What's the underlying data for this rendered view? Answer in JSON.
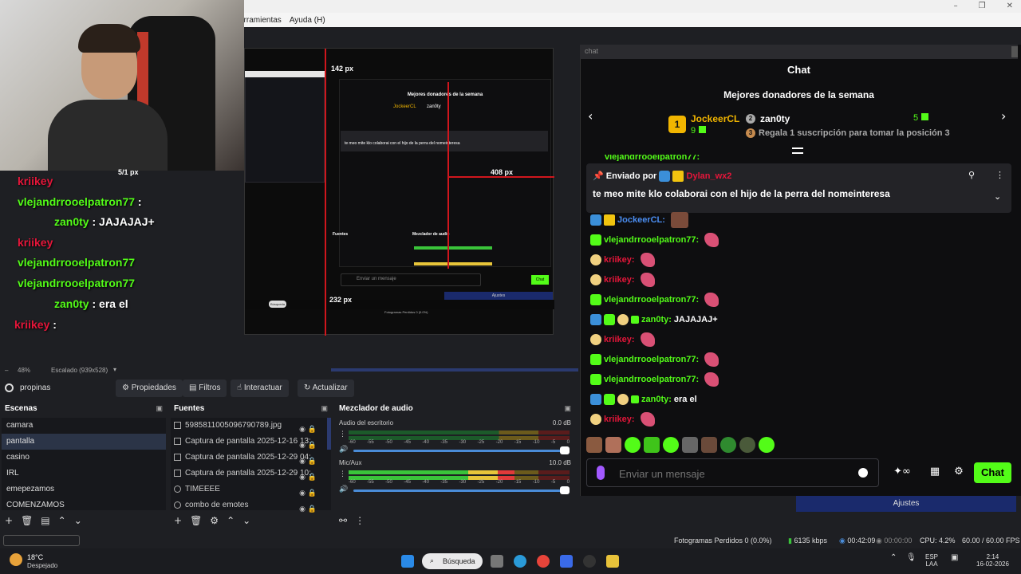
{
  "menu": {
    "items": [
      "erramientas",
      "Ayuda (H)"
    ]
  },
  "window_controls": [
    "–",
    "❐",
    "✕"
  ],
  "preview": {
    "labels": [
      "142 px",
      "5/1 px",
      "408 px",
      "232 px"
    ],
    "mini_title": "Mejores donadores de la semana",
    "mini_donor1": "JockeerCL",
    "mini_donor2": "zan0ty",
    "mini_pinned": "te meo mite klo colaborai con el hijo de la perra del nomeinteresa",
    "mini_input": "Enviar un mensaje",
    "mini_chat_btn": "Chat",
    "mini_ajustes": "Ajustes",
    "mini_status": "Fotogramas Perdidos 0 (0.0%)",
    "mini_search": "Búsqueda",
    "mini_buttons": [
      "Propiedades",
      "Filtros",
      "Interactuar",
      "Actualizar"
    ],
    "mini_dock_sources": "Fuentes",
    "mini_dock_mixer": "Mezclador de audio",
    "mini_scenes": [
      "camara",
      "pantalla",
      "casino",
      "IRL",
      "COMENZAMOS"
    ],
    "mini_sources": [
      "5985811005096790789.jpg",
      "Captura de pantalla 2025-12-16 13:",
      "Captura de pantalla 2025-12-29 04:",
      "combo de emotes"
    ]
  },
  "overlay_chat": [
    {
      "user": "kriikey",
      "sep": ":",
      "text": ""
    },
    {
      "user": "vlejandrrooelpatron77",
      "sep": " :",
      "text": ""
    },
    {
      "user": "zan0ty",
      "sep": " :",
      "text": " JAJAJAJ+"
    },
    {
      "user": "kriikey",
      "sep": " :",
      "text": ""
    },
    {
      "user": "vlejandrrooelpatron77",
      "sep": " :",
      "text": ""
    },
    {
      "user": "vlejandrrooelpatron77",
      "sep": " :",
      "text": ""
    },
    {
      "user": "zan0ty",
      "sep": " :",
      "text": " era el"
    },
    {
      "user": "kriikey",
      "sep": " :",
      "text": ""
    }
  ],
  "chat": {
    "url": "chat",
    "title": "Chat",
    "donors_title": "Mejores donadores de la semana",
    "donor1": {
      "rank": "1",
      "name": "JockeerCL",
      "amount": "9"
    },
    "donor2": {
      "rank": "2",
      "name": "zan0ty",
      "amount": "5"
    },
    "donor3": {
      "rank": "3",
      "text": "Regala 1 suscripción para tomar la posición 3"
    },
    "cut_user": "vlejandrrooelpatron77:",
    "pinned": {
      "sent_by": "Enviado por",
      "user": "Dylan_wx2",
      "message": "te meo mite klo colaborai con el hijo de la perra del nomeinteresa"
    },
    "messages": [
      {
        "user": "JockeerCL:",
        "text": "",
        "color": "#4b8df0"
      },
      {
        "user": "vlejandrrooelpatron77:",
        "text": "",
        "color": "#53fc18"
      },
      {
        "user": "kriikey:",
        "text": "",
        "color": "#e5163a"
      },
      {
        "user": "kriikey:",
        "text": "",
        "color": "#e5163a"
      },
      {
        "user": "vlejandrrooelpatron77:",
        "text": "",
        "color": "#53fc18"
      },
      {
        "user": "zan0ty:",
        "text": "JAJAJAJ+",
        "color": "#53fc18"
      },
      {
        "user": "kriikey:",
        "text": "",
        "color": "#e5163a"
      },
      {
        "user": "vlejandrrooelpatron77:",
        "text": "",
        "color": "#53fc18"
      },
      {
        "user": "vlejandrrooelpatron77:",
        "text": "",
        "color": "#53fc18"
      },
      {
        "user": "zan0ty:",
        "text": "era el",
        "color": "#53fc18"
      },
      {
        "user": "kriikey:",
        "text": "",
        "color": "#e5163a"
      }
    ],
    "input_placeholder": "Enviar un mensaje",
    "chat_button": "Chat",
    "ajustes": "Ajustes"
  },
  "scale": {
    "zoom": "48%",
    "scaled": "Escalado (939x528)"
  },
  "context": {
    "source": "propinas",
    "buttons": [
      "Propiedades",
      "Filtros",
      "Interactuar",
      "Actualizar"
    ]
  },
  "scenes": {
    "title": "Escenas",
    "items": [
      "camara",
      "pantalla",
      "casino",
      "IRL",
      "emepezamos",
      "COMENZAMOS"
    ],
    "selected_index": 1
  },
  "sources": {
    "title": "Fuentes",
    "items": [
      "5985811005096790789.jpg",
      "Captura de pantalla 2025-12-16 13:",
      "Captura de pantalla 2025-12-29 04:",
      "Captura de pantalla 2025-12-29 10:",
      "TIMEEEE",
      "combo de emotes"
    ]
  },
  "mixer": {
    "title": "Mezclador de audio",
    "channels": [
      {
        "name": "Audio del escritorio",
        "db": "0.0 dB",
        "level": 0.0,
        "volume": 1.0
      },
      {
        "name": "Mic/Aux",
        "db": "10.0 dB",
        "level": 0.75,
        "volume": 1.0
      }
    ],
    "scale": [
      "-60",
      "-55",
      "-50",
      "-45",
      "-40",
      "-35",
      "-30",
      "-25",
      "-20",
      "-15",
      "-10",
      "-5",
      "0"
    ]
  },
  "status": {
    "dropped": "Fotogramas Perdidos 0 (0.0%)",
    "bitrate": "6135 kbps",
    "stream_time": "00:42:09",
    "rec_time": "00:00:00",
    "cpu": "CPU: 4.2%",
    "fps": "60.00 / 60.00 FPS"
  },
  "taskbar": {
    "weather_temp": "18°C",
    "weather_desc": "Despejado",
    "search": "Búsqueda",
    "lang1": "ESP",
    "lang2": "LAA",
    "time": "2:14",
    "date": "16-02-2026"
  },
  "colors": {
    "kick_green": "#53fc18",
    "red_guides": "#d0161d",
    "selected_scene": "#2b3447",
    "ajustes_blue": "#1a2a6c"
  }
}
